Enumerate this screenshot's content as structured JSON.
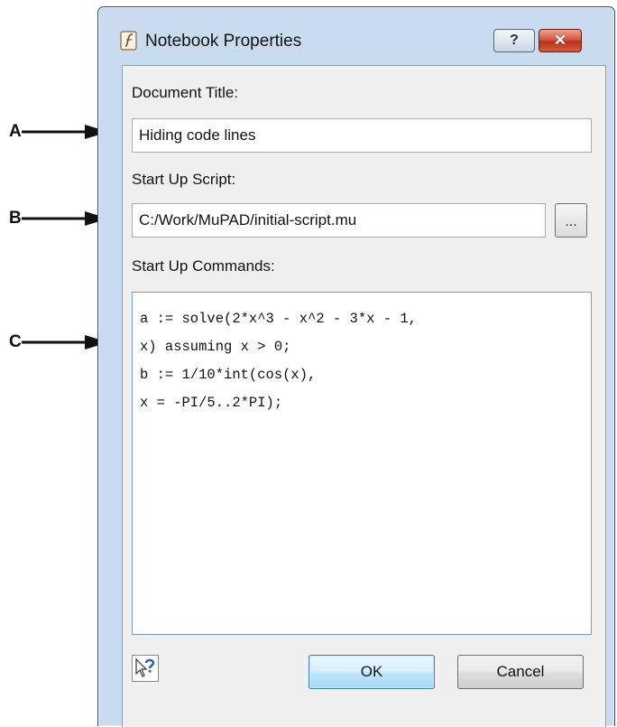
{
  "callouts": [
    "A",
    "B",
    "C"
  ],
  "window": {
    "title": "Notebook Properties",
    "help_button": "?",
    "close_button": "✕"
  },
  "document_title": {
    "label": "Document Title:",
    "value": "Hiding code lines"
  },
  "startup_script": {
    "label": "Start Up Script:",
    "value": "C:/Work/MuPAD/initial-script.mu",
    "browse_label": "..."
  },
  "startup_commands": {
    "label": "Start Up Commands:",
    "lines": [
      "a := solve(2*x^3 - x^2 - 3*x - 1,",
      "x) assuming x > 0;",
      "b := 1/10*int(cos(x),",
      "x = -PI/5..2*PI);"
    ]
  },
  "buttons": {
    "ok": "OK",
    "cancel": "Cancel"
  },
  "icons": {
    "app": "mupad-notebook-icon",
    "help": "help-pointer-icon",
    "close": "close-icon"
  },
  "colors": {
    "frame": "#c9dbee",
    "close_button": "#c73f26",
    "ok_button": "#bee6fd",
    "client_bg": "#f0f0f0"
  }
}
